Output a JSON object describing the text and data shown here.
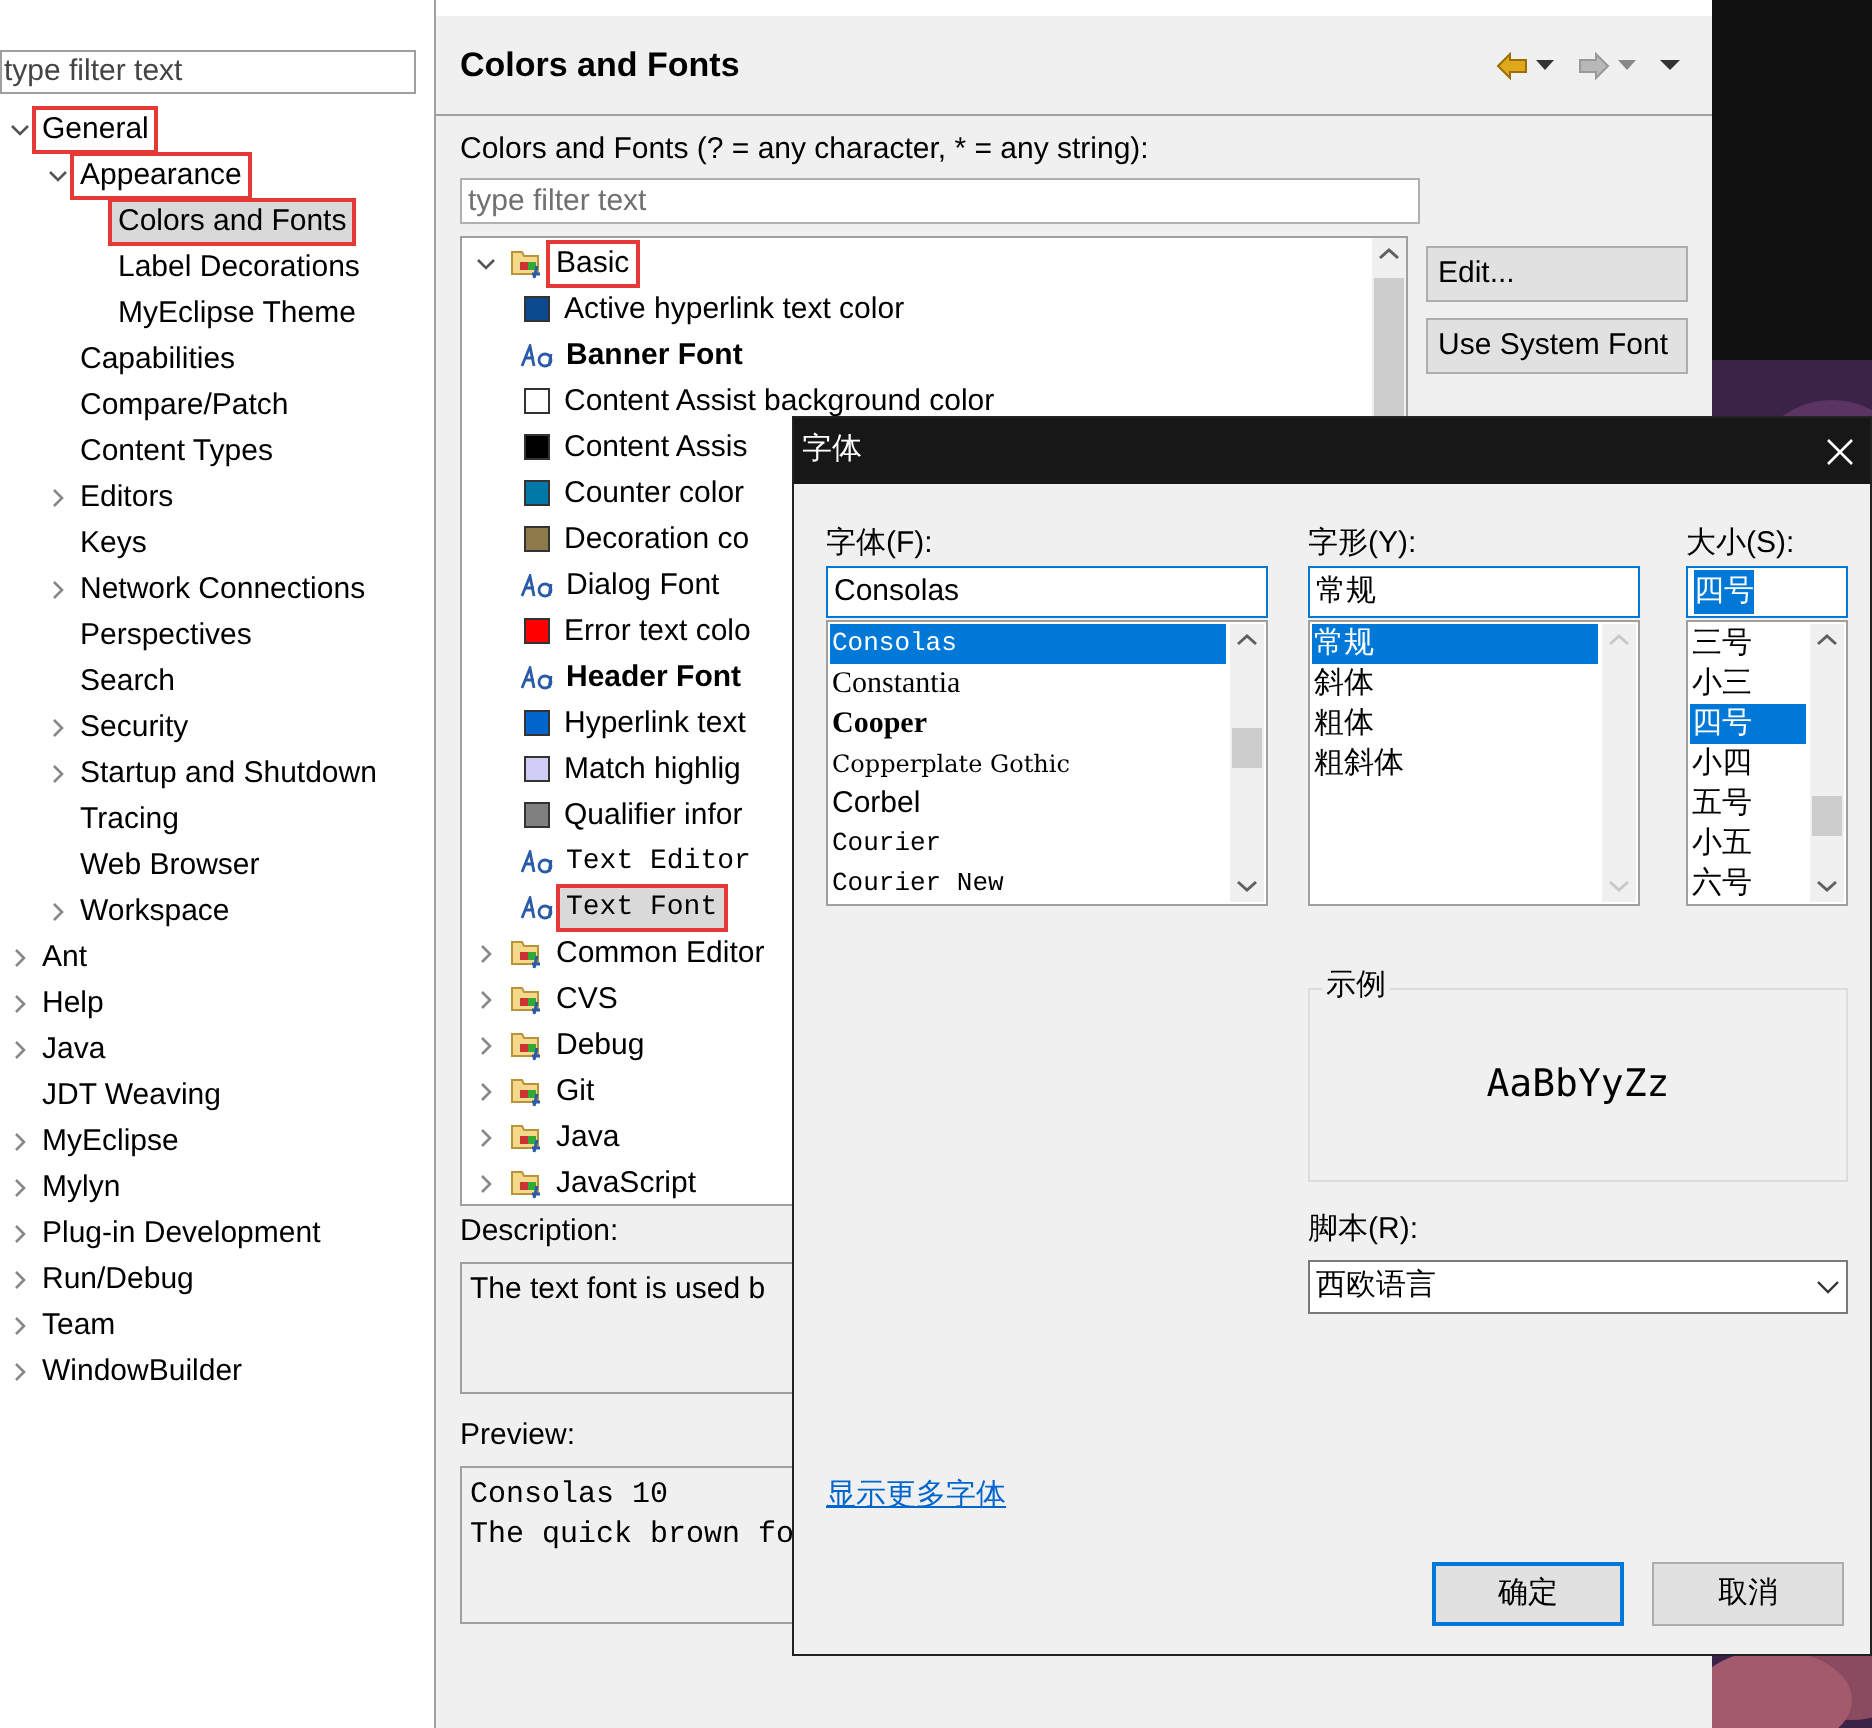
{
  "sidebar": {
    "filter": {
      "placeholder": "type filter text"
    },
    "items": [
      {
        "label": "General",
        "kind": "branch",
        "expanded": true,
        "selected": false,
        "marked": true,
        "children": [
          {
            "label": "Appearance",
            "kind": "branch",
            "expanded": true,
            "selected": false,
            "marked": true,
            "children": [
              {
                "label": "Colors and Fonts",
                "kind": "leaf",
                "selected": true,
                "marked": true
              },
              {
                "label": "Label Decorations",
                "kind": "leaf",
                "selected": false,
                "marked": false
              },
              {
                "label": "MyEclipse Theme",
                "kind": "leaf",
                "selected": false,
                "marked": false
              }
            ]
          },
          {
            "label": "Capabilities",
            "kind": "leaf",
            "selected": false,
            "marked": false
          },
          {
            "label": "Compare/Patch",
            "kind": "leaf",
            "selected": false,
            "marked": false
          },
          {
            "label": "Content Types",
            "kind": "leaf",
            "selected": false,
            "marked": false
          },
          {
            "label": "Editors",
            "kind": "branch",
            "expanded": false,
            "selected": false,
            "marked": false
          },
          {
            "label": "Keys",
            "kind": "leaf",
            "selected": false,
            "marked": false
          },
          {
            "label": "Network Connections",
            "kind": "branch",
            "expanded": false,
            "selected": false,
            "marked": false
          },
          {
            "label": "Perspectives",
            "kind": "leaf",
            "selected": false,
            "marked": false
          },
          {
            "label": "Search",
            "kind": "leaf",
            "selected": false,
            "marked": false
          },
          {
            "label": "Security",
            "kind": "branch",
            "expanded": false,
            "selected": false,
            "marked": false
          },
          {
            "label": "Startup and Shutdown",
            "kind": "branch",
            "expanded": false,
            "selected": false,
            "marked": false
          },
          {
            "label": "Tracing",
            "kind": "leaf",
            "selected": false,
            "marked": false
          },
          {
            "label": "Web Browser",
            "kind": "leaf",
            "selected": false,
            "marked": false
          },
          {
            "label": "Workspace",
            "kind": "branch",
            "expanded": false,
            "selected": false,
            "marked": false
          }
        ]
      },
      {
        "label": "Ant",
        "kind": "branch",
        "expanded": false,
        "selected": false,
        "marked": false
      },
      {
        "label": "Help",
        "kind": "branch",
        "expanded": false,
        "selected": false,
        "marked": false
      },
      {
        "label": "Java",
        "kind": "branch",
        "expanded": false,
        "selected": false,
        "marked": false
      },
      {
        "label": "JDT Weaving",
        "kind": "leaf",
        "selected": false,
        "marked": false
      },
      {
        "label": "MyEclipse",
        "kind": "branch",
        "expanded": false,
        "selected": false,
        "marked": false
      },
      {
        "label": "Mylyn",
        "kind": "branch",
        "expanded": false,
        "selected": false,
        "marked": false
      },
      {
        "label": "Plug-in Development",
        "kind": "branch",
        "expanded": false,
        "selected": false,
        "marked": false
      },
      {
        "label": "Run/Debug",
        "kind": "branch",
        "expanded": false,
        "selected": false,
        "marked": false
      },
      {
        "label": "Team",
        "kind": "branch",
        "expanded": false,
        "selected": false,
        "marked": false
      },
      {
        "label": "WindowBuilder",
        "kind": "branch",
        "expanded": false,
        "selected": false,
        "marked": false
      }
    ]
  },
  "page": {
    "title": "Colors and Fonts",
    "nav": [
      {
        "kind": "back",
        "disabled": false
      },
      {
        "kind": "forward",
        "disabled": true
      }
    ],
    "filter_label": "Colors and Fonts (? = any character, * = any string):",
    "filter": {
      "placeholder": "type filter text"
    },
    "tree": [
      {
        "label": "Basic",
        "kind": "category",
        "expanded": true,
        "selected": false,
        "marked": true,
        "children": [
          {
            "label": "Active hyperlink text color",
            "kind": "color",
            "color": "#0b4a8f",
            "selected": false,
            "marked": false
          },
          {
            "label": "Banner Font",
            "kind": "bold-font",
            "selected": false,
            "marked": false
          },
          {
            "label": "Content Assist background color",
            "kind": "color",
            "color": "#ffffff",
            "selected": false,
            "marked": false
          },
          {
            "label": "Content Assis",
            "kind": "color",
            "color": "#000000",
            "selected": false,
            "marked": false
          },
          {
            "label": "Counter color",
            "kind": "color",
            "color": "#0079a8",
            "selected": false,
            "marked": false
          },
          {
            "label": "Decoration co",
            "kind": "color",
            "color": "#8c7a4b",
            "selected": false,
            "marked": false
          },
          {
            "label": "Dialog Font",
            "kind": "font",
            "selected": false,
            "marked": false
          },
          {
            "label": "Error text colo",
            "kind": "color",
            "color": "#ff0000",
            "selected": false,
            "marked": false
          },
          {
            "label": "Header Font",
            "kind": "bold-font",
            "selected": false,
            "marked": false
          },
          {
            "label": "Hyperlink text",
            "kind": "color",
            "color": "#0066cc",
            "selected": false,
            "marked": false
          },
          {
            "label": "Match highlig",
            "kind": "color",
            "color": "#d0cdf5",
            "selected": false,
            "marked": false
          },
          {
            "label": "Qualifier infor",
            "kind": "color",
            "color": "#808080",
            "selected": false,
            "marked": false
          },
          {
            "label": "Text Editor",
            "kind": "mono-font",
            "selected": false,
            "marked": false
          },
          {
            "label": "Text Font",
            "kind": "mono-font",
            "selected": true,
            "marked": true
          }
        ]
      },
      {
        "label": "Common Editor",
        "kind": "category",
        "expanded": false,
        "selected": false,
        "marked": false
      },
      {
        "label": "CVS",
        "kind": "category",
        "expanded": false,
        "selected": false,
        "marked": false
      },
      {
        "label": "Debug",
        "kind": "category",
        "expanded": false,
        "selected": false,
        "marked": false
      },
      {
        "label": "Git",
        "kind": "category",
        "expanded": false,
        "selected": false,
        "marked": false
      },
      {
        "label": "Java",
        "kind": "category",
        "expanded": false,
        "selected": false,
        "marked": false
      },
      {
        "label": "JavaScript",
        "kind": "category",
        "expanded": false,
        "selected": false,
        "marked": false
      }
    ],
    "buttons": [
      "Edit...",
      "Use System Font"
    ],
    "description_label": "Description:",
    "description": "The text font is used b",
    "preview_label": "Preview:",
    "preview": [
      "Consolas 10",
      "The quick brown fo"
    ]
  },
  "dialog": {
    "title": "字体",
    "columns": [
      {
        "label": "字体(F):",
        "value": "Consolas",
        "value_selected": false,
        "scroll_disabled": false,
        "options": [
          {
            "text": "Consolas",
            "kind": "mono",
            "selected": true
          },
          {
            "text": "Constantia",
            "kind": "serif",
            "selected": false
          },
          {
            "text": "Cooper",
            "kind": "heavy",
            "selected": false
          },
          {
            "text": "Copperplate Gothic",
            "kind": "wide",
            "selected": false
          },
          {
            "text": "Corbel",
            "kind": "sans",
            "selected": false
          },
          {
            "text": "Courier",
            "kind": "mono",
            "selected": false
          },
          {
            "text": "Courier New",
            "kind": "mono",
            "selected": false
          }
        ]
      },
      {
        "label": "字形(Y):",
        "value": "常规",
        "value_selected": false,
        "scroll_disabled": true,
        "options": [
          {
            "text": "常规",
            "kind": "sans",
            "selected": true
          },
          {
            "text": "斜体",
            "kind": "sans",
            "selected": false
          },
          {
            "text": "粗体",
            "kind": "sans",
            "selected": false
          },
          {
            "text": "粗斜体",
            "kind": "sans",
            "selected": false
          }
        ]
      },
      {
        "label": "大小(S):",
        "value": "四号",
        "value_selected": true,
        "scroll_disabled": false,
        "options": [
          {
            "text": "三号",
            "kind": "sans",
            "selected": false
          },
          {
            "text": "小三",
            "kind": "sans",
            "selected": false
          },
          {
            "text": "四号",
            "kind": "sans",
            "selected": true
          },
          {
            "text": "小四",
            "kind": "sans",
            "selected": false
          },
          {
            "text": "五号",
            "kind": "sans",
            "selected": false
          },
          {
            "text": "小五",
            "kind": "sans",
            "selected": false
          },
          {
            "text": "六号",
            "kind": "sans",
            "selected": false
          }
        ]
      }
    ],
    "sample": {
      "label": "示例",
      "text": "AaBbYyZz"
    },
    "script": {
      "label": "脚本(R):",
      "value": "西欧语言"
    },
    "link": "显示更多字体",
    "buttons": [
      {
        "label": "确定",
        "default": true
      },
      {
        "label": "取消",
        "default": false
      }
    ]
  }
}
